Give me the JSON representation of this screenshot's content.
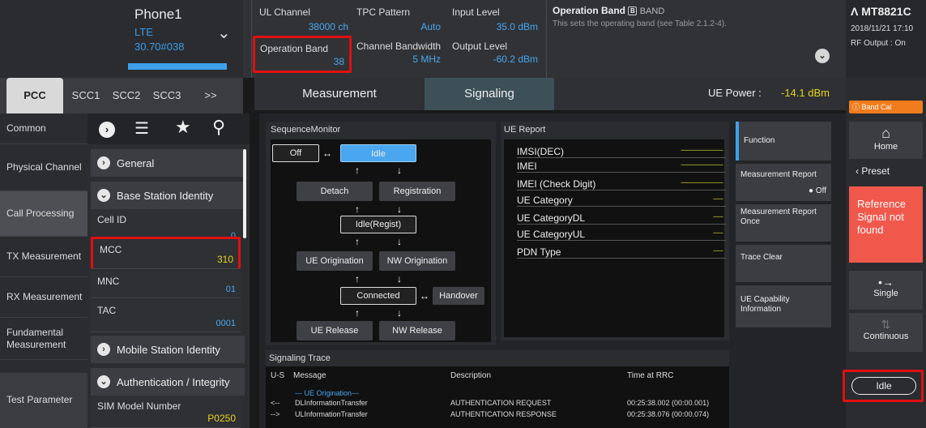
{
  "device": {
    "name": "Phone1",
    "rat": "LTE",
    "version": "30.70#038"
  },
  "params": {
    "ul_channel": {
      "label": "UL Channel",
      "value": "38000 ch"
    },
    "tpc_pattern": {
      "label": "TPC Pattern",
      "value": "Auto"
    },
    "input_level": {
      "label": "Input Level",
      "value": "35.0 dBm"
    },
    "operation_band": {
      "label": "Operation Band",
      "value": "38"
    },
    "channel_bandwidth": {
      "label": "Channel Bandwidth",
      "value": "5 MHz"
    },
    "output_level": {
      "label": "Output Level",
      "value": "-60.2 dBm"
    }
  },
  "help": {
    "title": "Operation Band",
    "title_suffix": "BAND",
    "text": "This sets the operating band (see Table 2.1.2-4)."
  },
  "instrument": {
    "model": "MT8821C",
    "datetime": "2018/11/21 17:10",
    "rf_output": "RF Output : On"
  },
  "cc_tabs": [
    "PCC",
    "SCC1",
    "SCC2",
    "SCC3",
    ">>"
  ],
  "main_tabs": {
    "measurement": "Measurement",
    "signaling": "Signaling"
  },
  "ue_power": {
    "label": "UE Power :",
    "value": "-14.1 dBm"
  },
  "band_cal": "Band Cal",
  "sidebar": [
    "Common",
    "Physical Channel",
    "Call Processing",
    "TX Measurement",
    "RX Measurement",
    "Fundamental Measurement",
    "Test Parameter"
  ],
  "sections": {
    "general": "General",
    "bsi": "Base Station Identity",
    "msi": "Mobile Station Identity",
    "auth": "Authentication / Integrity"
  },
  "fields": {
    "cell_id": {
      "label": "Cell ID",
      "value": "0"
    },
    "mcc": {
      "label": "MCC",
      "value": "310"
    },
    "mnc": {
      "label": "MNC",
      "value": "01"
    },
    "tac": {
      "label": "TAC",
      "value": "0001"
    },
    "sim": {
      "label": "SIM Model Number",
      "value": "P0250"
    }
  },
  "sequence": {
    "title": "SequenceMonitor",
    "off": "Off",
    "idle": "Idle",
    "detach": "Detach",
    "registration": "Registration",
    "idle_regist": "Idle(Regist)",
    "ue_orig": "UE Origination",
    "nw_orig": "NW Origination",
    "connected": "Connected",
    "handover": "Handover",
    "ue_release": "UE Release",
    "nw_release": "NW Release"
  },
  "ue_report": {
    "title": "UE Report",
    "rows": [
      "IMSI(DEC)",
      "IMEI",
      "IMEI (Check Digit)",
      "UE Category",
      "UE CategoryDL",
      "UE CategoryUL",
      "PDN Type"
    ],
    "dashes": [
      "--------------------------",
      "--------------------------",
      "--------------------------",
      "------",
      "------",
      "------",
      "------"
    ]
  },
  "functions": {
    "function": "Function",
    "meas_report": "Measurement Report",
    "meas_report_state": "Off",
    "meas_once": "Measurement Report Once",
    "trace_clear": "Trace Clear",
    "ue_cap": "UE Capability Information"
  },
  "right": {
    "home": "Home",
    "preset": "Preset",
    "ref_signal": "Reference Signal not found",
    "single": "Single",
    "continuous": "Continuous",
    "idle": "Idle"
  },
  "trace": {
    "title": "Signaling Trace",
    "headers": {
      "us": "U-S",
      "message": "Message",
      "description": "Description",
      "time": "Time at RRC"
    },
    "rows": [
      {
        "dir": "",
        "msg": "--- UE Origination---",
        "desc": "",
        "time": ""
      },
      {
        "dir": "<--",
        "msg": "DLInformationTransfer",
        "desc": "AUTHENTICATION REQUEST",
        "time": "00:25:38.002 (00:00.001)"
      },
      {
        "dir": "-->",
        "msg": "ULInformationTransfer",
        "desc": "AUTHENTICATION RESPONSE",
        "time": "00:25:38.076 (00:00.074)"
      }
    ]
  },
  "colors": {
    "accent": "#3fa0ea",
    "highlight": "#e01010",
    "warning": "#f07c1e",
    "alert": "#f0584c",
    "value_yellow": "#e8d21a"
  }
}
